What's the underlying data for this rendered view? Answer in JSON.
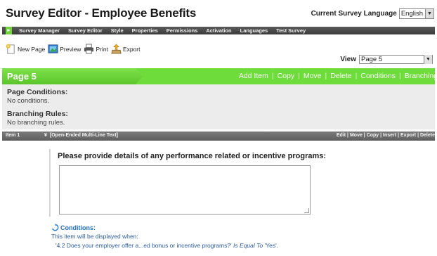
{
  "app": {
    "title": "Survey Editor - Employee Benefits",
    "language_label": "Current Survey Language",
    "language_value": "English"
  },
  "nav": {
    "items": [
      "Survey Manager",
      "Survey Editor",
      "Style",
      "Properties",
      "Permissions",
      "Activation",
      "Languages",
      "Test Survey"
    ]
  },
  "toolbar": {
    "new_page": "New Page",
    "preview": "Preview",
    "print": "Print",
    "export": "Export"
  },
  "view": {
    "label": "View",
    "value": "Page 5"
  },
  "page": {
    "title": "Page 5",
    "actions": [
      "Add Item",
      "Copy",
      "Move",
      "Delete",
      "Conditions",
      "Branching"
    ]
  },
  "conditions_panel": {
    "page_conditions_label": "Page Conditions:",
    "page_conditions_value": "No conditions.",
    "branching_label": "Branching Rules:",
    "branching_value": "No branching rules."
  },
  "item": {
    "number": "Item 1",
    "type": "[Open-Ended Multi-Line Text]",
    "actions_text": "Edit | Move | Copy | Insert | Export | Delete",
    "question": "Please provide details of any performance related or incentive programs:"
  },
  "item_conditions": {
    "title": "Conditions:",
    "intro": "This item will be displayed when:",
    "rule_question": "'4.2 Does your employer offer a...ed bonus or incentive programs?'",
    "rule_operator": "Is Equal To",
    "rule_value": "'Yes'."
  },
  "colors": {
    "accent_green": "#6edc3a",
    "nav_dark": "#4a4a4a",
    "link_blue": "#1f6fc6"
  }
}
